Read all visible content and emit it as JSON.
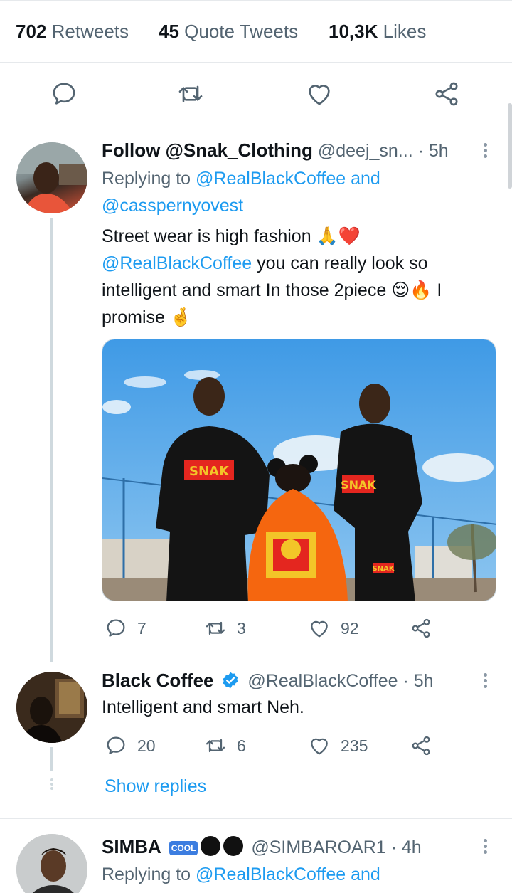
{
  "stats": {
    "retweets_count": "702",
    "retweets_label": "Retweets",
    "quotes_count": "45",
    "quotes_label": "Quote Tweets",
    "likes_count": "10,3K",
    "likes_label": "Likes"
  },
  "main_actions": {
    "icons": [
      "reply-icon",
      "retweet-icon",
      "like-icon",
      "share-icon"
    ]
  },
  "replies": [
    {
      "display_name": "Follow @Snak_Clothing",
      "handle": "@deej_sn...",
      "time": "· 5h",
      "replying_prefix": "Replying to",
      "replying_mentions_line1": "@RealBlackCoffee and",
      "replying_mentions_line2": "@casspernyovest",
      "text_line1": "Street wear is high fashion 🙏❤️",
      "text_mention": "@RealBlackCoffee",
      "text_line2_rest": " you can really look so",
      "text_line3": "intelligent and smart In those 2piece 😌🔥 I",
      "text_line4": "promise 🤞",
      "replies": "7",
      "retweets": "3",
      "likes": "92"
    },
    {
      "display_name": "Black Coffee",
      "handle": "@RealBlackCoffee",
      "time": "· 5h",
      "text": "Intelligent and smart Neh.",
      "replies": "20",
      "retweets": "6",
      "likes": "235",
      "show_replies": "Show replies"
    },
    {
      "display_name": "SIMBA",
      "badge": "COOL",
      "handle": "@SIMBAROAR1",
      "time": "· 4h",
      "replying_prefix": "Replying to",
      "replying_mentions_line1": "@RealBlackCoffee and"
    }
  ],
  "photo": {
    "hoodie_text_left": "SNAK",
    "hoodie_text_right": "SNAK",
    "pants_text": "SNAK"
  },
  "colors": {
    "accent": "#1d9bf0",
    "text": "#0f1419",
    "muted": "#536471",
    "border": "#e6e9ec"
  }
}
